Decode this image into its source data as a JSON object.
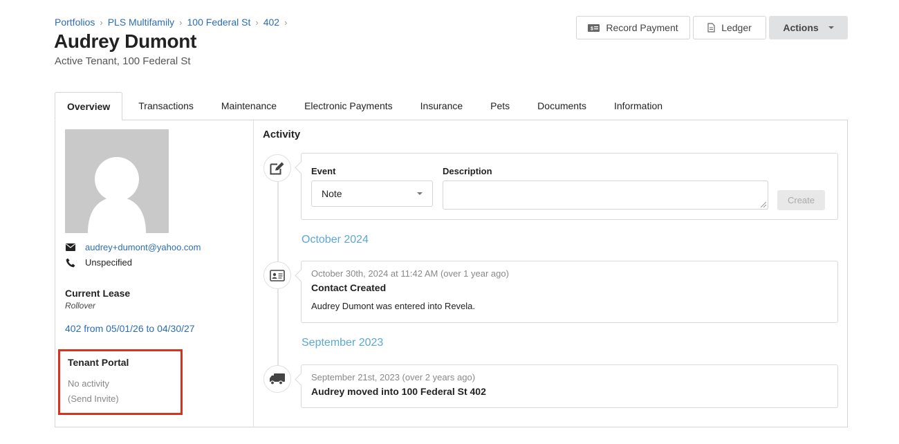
{
  "breadcrumb": [
    "Portfolios",
    "PLS Multifamily",
    "100 Federal St",
    "402"
  ],
  "page": {
    "title": "Audrey Dumont",
    "subtitle": "Active Tenant, 100 Federal St"
  },
  "toolbar": {
    "record_payment": "Record Payment",
    "ledger": "Ledger",
    "actions": "Actions"
  },
  "tabs": [
    "Overview",
    "Transactions",
    "Maintenance",
    "Electronic Payments",
    "Insurance",
    "Pets",
    "Documents",
    "Information"
  ],
  "contact": {
    "email": "audrey+dumont@yahoo.com",
    "phone": "Unspecified"
  },
  "lease": {
    "heading": "Current Lease",
    "type": "Rollover",
    "link": "402 from 05/01/26 to 04/30/27"
  },
  "portal": {
    "heading": "Tenant Portal",
    "status": "No activity",
    "invite": "(Send Invite)"
  },
  "activity": {
    "title": "Activity",
    "form": {
      "event_label": "Event",
      "event_value": "Note",
      "description_label": "Description",
      "create": "Create"
    },
    "groups": [
      {
        "month": "October 2024",
        "time": "October 30th, 2024 at 11:42 AM (over 1 year ago)",
        "title": "Contact Created",
        "body": "Audrey Dumont was entered into Revela."
      },
      {
        "month": "September 2023",
        "time": "September 21st, 2023 (over 2 years ago)",
        "title": "Audrey moved into 100 Federal St 402"
      }
    ]
  },
  "colors": {
    "link": "#2a6db5",
    "month": "#5aa8d4",
    "highlight": "#d8321c"
  }
}
